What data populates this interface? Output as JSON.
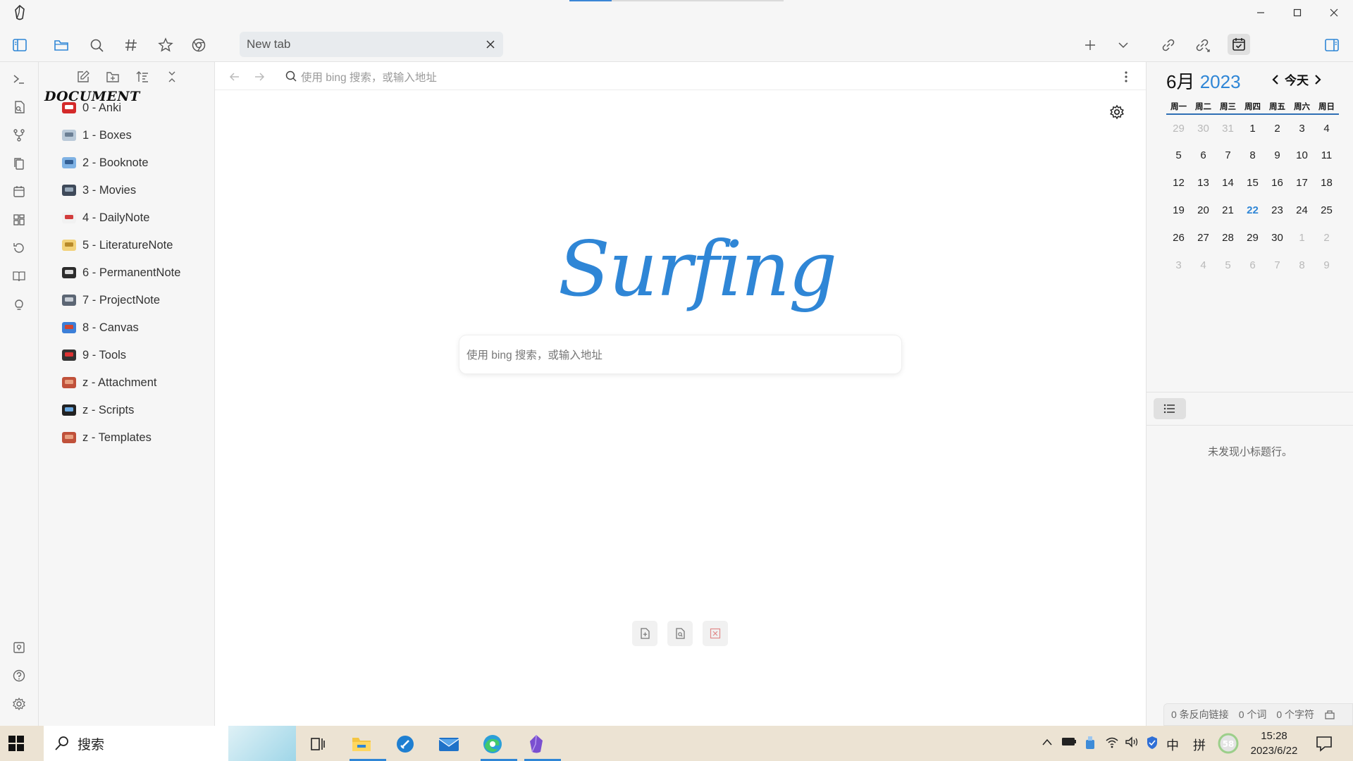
{
  "window": {
    "controls": {
      "minimize": "—",
      "maximize": "☐",
      "close": "✕"
    }
  },
  "tab": {
    "title": "New tab"
  },
  "navbar": {
    "address_placeholder": "使用 bing 搜索，或输入地址"
  },
  "explorer": {
    "vault_name": "DOCUMENT",
    "folders": [
      {
        "label": "0 - Anki",
        "icon": "anki-icon"
      },
      {
        "label": "1 - Boxes",
        "icon": "box-icon"
      },
      {
        "label": "2 - Booknote",
        "icon": "book-icon"
      },
      {
        "label": "3 - Movies",
        "icon": "film-icon"
      },
      {
        "label": "4 - DailyNote",
        "icon": "calendar-icon"
      },
      {
        "label": "5 - LiteratureNote",
        "icon": "scroll-icon"
      },
      {
        "label": "6 - PermanentNote",
        "icon": "floppy-disk-icon"
      },
      {
        "label": "7 - ProjectNote",
        "icon": "file-cabinet-icon"
      },
      {
        "label": "8 - Canvas",
        "icon": "paintbrush-icon"
      },
      {
        "label": "9 - Tools",
        "icon": "joystick-icon"
      },
      {
        "label": "z - Attachment",
        "icon": "brick-icon"
      },
      {
        "label": "z - Scripts",
        "icon": "videocassette-icon"
      },
      {
        "label": "z - Templates",
        "icon": "brick-icon"
      }
    ]
  },
  "surfing": {
    "logo": "Surfing",
    "search_placeholder": "使用 bing 搜索，或输入地址"
  },
  "calendar": {
    "month": "6月",
    "year": "2023",
    "today_label": "今天",
    "weekdays": [
      "周一",
      "周二",
      "周三",
      "周四",
      "周五",
      "周六",
      "周日"
    ],
    "weeks": [
      [
        "29",
        "30",
        "31",
        "1",
        "2",
        "3",
        "4"
      ],
      [
        "5",
        "6",
        "7",
        "8",
        "9",
        "10",
        "11"
      ],
      [
        "12",
        "13",
        "14",
        "15",
        "16",
        "17",
        "18"
      ],
      [
        "19",
        "20",
        "21",
        "22",
        "23",
        "24",
        "25"
      ],
      [
        "26",
        "27",
        "28",
        "29",
        "30",
        "1",
        "2"
      ],
      [
        "3",
        "4",
        "5",
        "6",
        "7",
        "8",
        "9"
      ]
    ],
    "today": "22"
  },
  "outline": {
    "empty_text": "未发现小标题行。"
  },
  "status": {
    "backlinks": "0 条反向链接",
    "words": "0 个词",
    "chars": "0 个字符"
  },
  "taskbar": {
    "search_label": "搜索",
    "ime_lang": "中",
    "ime_mode": "拼",
    "badge": "58",
    "time": "15:28",
    "date": "2023/6/22"
  },
  "colors": {
    "accent": "#2f86d6",
    "sidebar_bg": "#f6f6f6",
    "taskbar_bg": "#ece3d3"
  }
}
